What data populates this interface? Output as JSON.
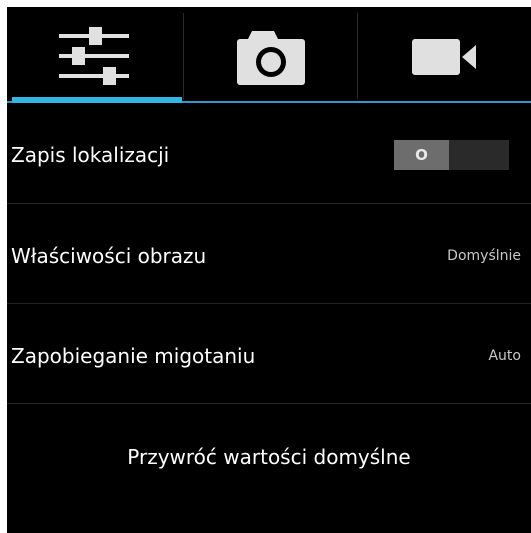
{
  "tabs": [
    {
      "id": "settings",
      "icon": "sliders-icon",
      "active": true
    },
    {
      "id": "camera",
      "icon": "camera-icon",
      "active": false
    },
    {
      "id": "video",
      "icon": "video-camera-icon",
      "active": false
    }
  ],
  "settings": {
    "location": {
      "label": "Zapis lokalizacji",
      "toggle_text": "O",
      "enabled": false
    },
    "image_properties": {
      "label": "Właściwości obrazu",
      "value": "Domyślnie"
    },
    "anti_flicker": {
      "label": "Zapobieganie migotaniu",
      "value": "Auto"
    },
    "reset_label": "Przywróć wartości domyślne"
  },
  "colors": {
    "background": "#000000",
    "accent": "#33b5e5",
    "icon": "#e0e0e0"
  }
}
